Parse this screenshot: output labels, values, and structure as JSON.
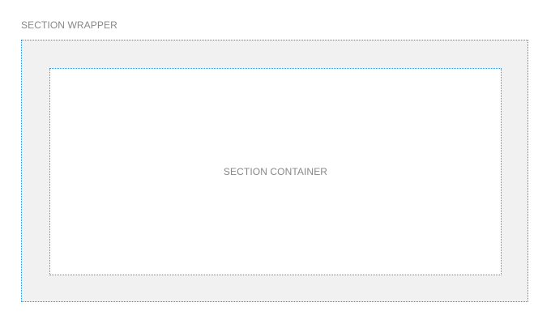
{
  "wrapper": {
    "label": "SECTION WRAPPER"
  },
  "container": {
    "label": "SECTION CONTAINER"
  },
  "colors": {
    "border": "#3b8fd0",
    "wrapper_fill": "#f1f1f1",
    "container_fill": "#ffffff",
    "label_text": "#888888"
  }
}
